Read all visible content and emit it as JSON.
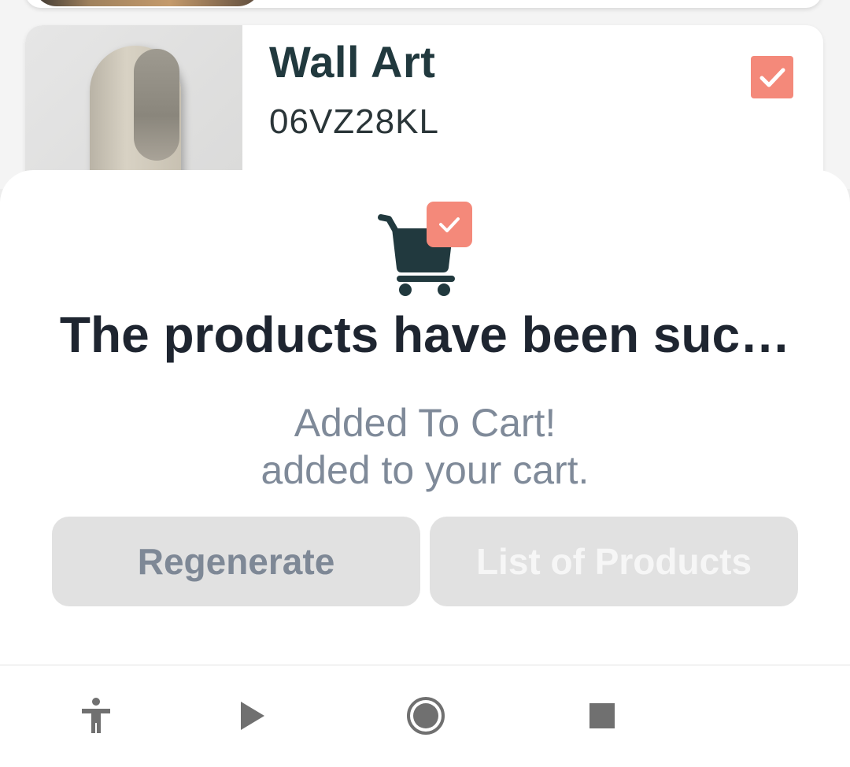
{
  "product": {
    "title": "Wall Art",
    "code": "06VZ28KL",
    "selected": true,
    "thumbnail": "wall-mirror-image"
  },
  "sheet": {
    "icon": "cart-check-icon",
    "title": "The products have been suc…",
    "subtitle_line1": "Added To Cart!",
    "subtitle_line2": "added to your cart.",
    "regenerate_label": "Regenerate",
    "list_label": "List of Products"
  },
  "navbar": {
    "items": [
      "accessibility-icon",
      "play-icon",
      "record-icon",
      "stop-icon"
    ]
  },
  "colors": {
    "accent": "#f4897a",
    "dark": "#21393e",
    "muted": "#7f8a99",
    "button_bg": "#e1e1e1"
  }
}
